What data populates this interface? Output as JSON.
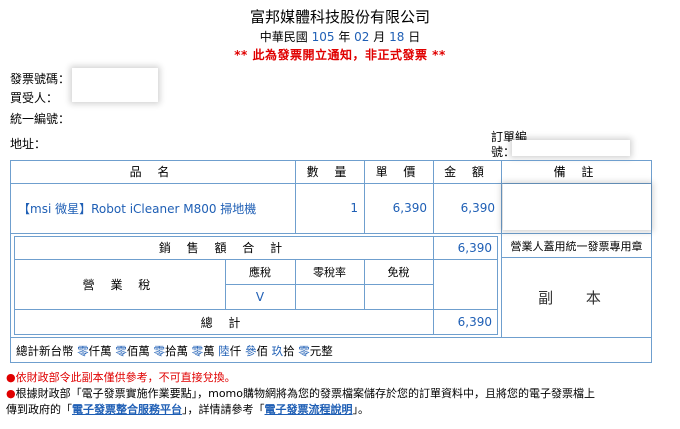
{
  "header": {
    "company": "富邦媒體科技股份有限公司",
    "date": {
      "era": "中華民國",
      "year": "105",
      "year_unit": "年",
      "month": "02",
      "month_unit": "月",
      "day": "18",
      "day_unit": "日"
    },
    "notice": "** 此為發票開立通知，非正式發票 **"
  },
  "fields": {
    "invoice_no_label": "發票號碼：",
    "buyer_label": "買受人：",
    "tax_id_label": "統一編號：",
    "address_label": "地址：",
    "order_no_label_1": "訂單編",
    "order_no_label_2": "號："
  },
  "table": {
    "col_name": "品 名",
    "col_qty": "數 量",
    "col_price": "單 價",
    "col_amount": "金 額",
    "col_remark": "備 註",
    "item": {
      "name": "【msi 微星】Robot iCleaner M800 掃地機",
      "qty": "1",
      "price": "6,390",
      "amount": "6,390"
    },
    "sales_total_label": "銷 售 額 合 計",
    "sales_total": "6,390",
    "stamp_label": "營業人蓋用統一發票專用章",
    "tax_label": "營 業 稅",
    "taxable": "應稅",
    "zero_rate": "零稅率",
    "exempt": "免稅",
    "taxable_mark": "V",
    "total_label": "總 計",
    "total": "6,390",
    "copy_label": "副 本"
  },
  "amount_words": {
    "prefix": "總計新台幣",
    "parts": [
      {
        "d": "零",
        "u": "仟萬"
      },
      {
        "d": "零",
        "u": "佰萬"
      },
      {
        "d": "零",
        "u": "拾萬"
      },
      {
        "d": "零",
        "u": "萬"
      },
      {
        "d": "陸",
        "u": "仟"
      },
      {
        "d": "參",
        "u": "佰"
      },
      {
        "d": "玖",
        "u": "拾"
      },
      {
        "d": "零",
        "u": "元整"
      }
    ]
  },
  "footer": {
    "line1": "依財政部令此副本僅供參考，不可直接兌換。",
    "line2a": "根據財政部「電子發票實施作業要點」，momo購物網將為您的發票檔案儲存於您的訂單資料中，且將您的電子發票檔上",
    "line2b_pre": "傳到政府的「",
    "link1": "電子發票整合服務平台",
    "line2b_mid": "」，詳情請參考「",
    "link2": "電子發票流程說明",
    "line2b_post": "」。"
  }
}
